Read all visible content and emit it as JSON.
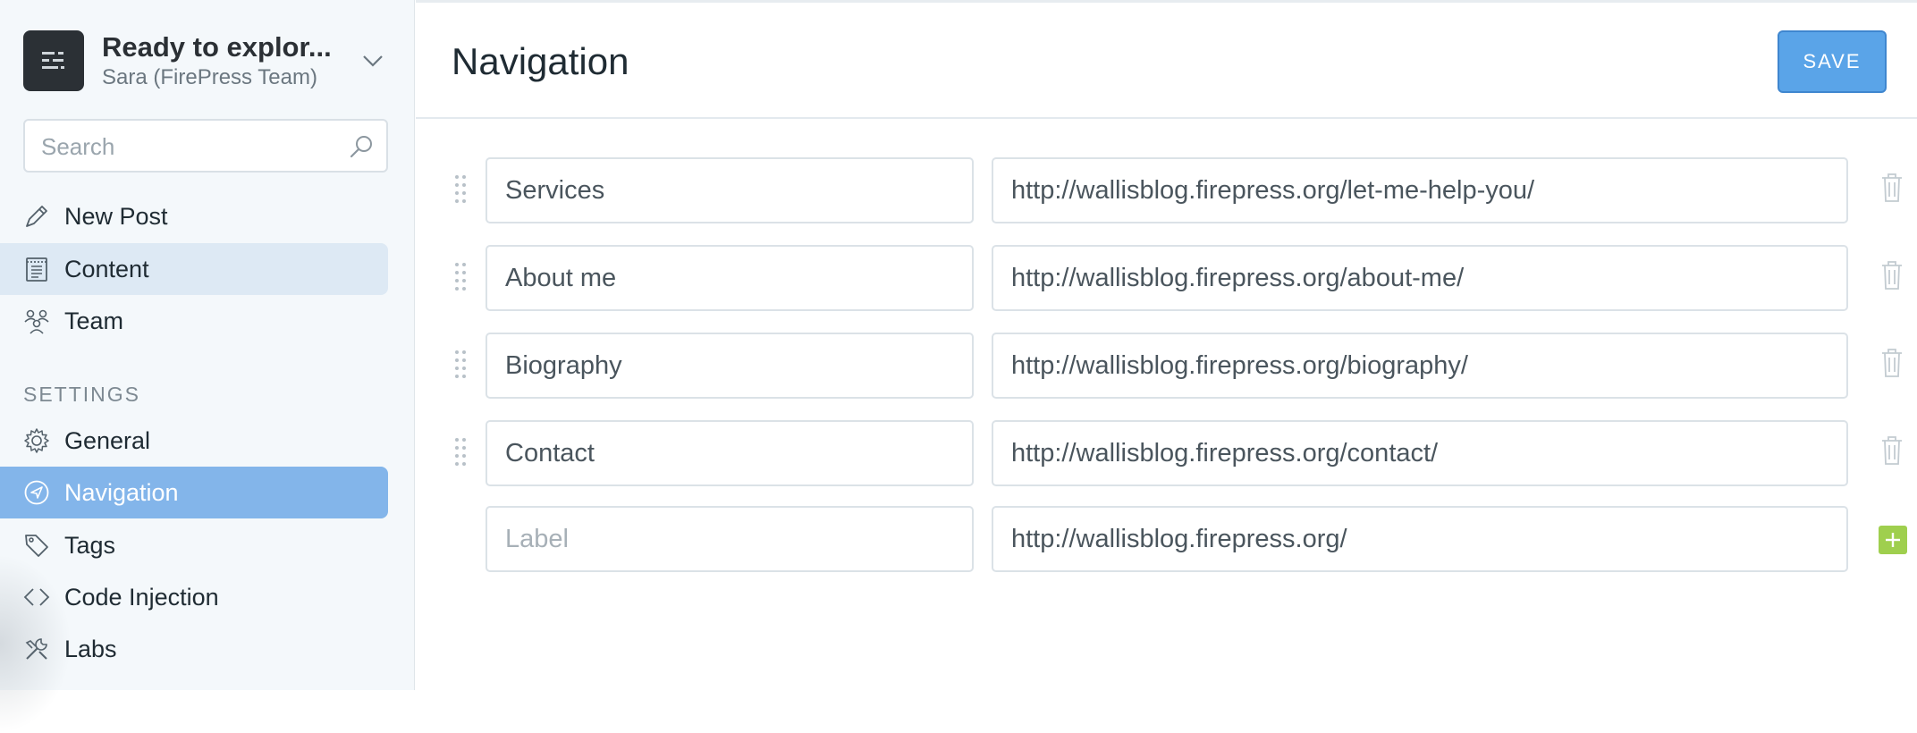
{
  "blog": {
    "title": "Ready to explor...",
    "user": "Sara (FirePress Team)"
  },
  "search": {
    "placeholder": "Search"
  },
  "sidebar": {
    "items": [
      {
        "label": "New Post",
        "icon": "pencil-icon"
      },
      {
        "label": "Content",
        "icon": "content-icon"
      },
      {
        "label": "Team",
        "icon": "team-icon"
      }
    ],
    "settings_label": "SETTINGS",
    "settings_items": [
      {
        "label": "General",
        "icon": "gear-icon"
      },
      {
        "label": "Navigation",
        "icon": "compass-icon"
      },
      {
        "label": "Tags",
        "icon": "tag-icon"
      },
      {
        "label": "Code Injection",
        "icon": "code-icon"
      },
      {
        "label": "Labs",
        "icon": "tools-icon"
      }
    ]
  },
  "page": {
    "title": "Navigation",
    "save_label": "SAVE"
  },
  "navigation": {
    "items": [
      {
        "label": "Services",
        "url": "http://wallisblog.firepress.org/let-me-help-you/"
      },
      {
        "label": "About me",
        "url": "http://wallisblog.firepress.org/about-me/"
      },
      {
        "label": "Biography",
        "url": "http://wallisblog.firepress.org/biography/"
      },
      {
        "label": "Contact",
        "url": "http://wallisblog.firepress.org/contact/"
      }
    ],
    "new_item": {
      "label_placeholder": "Label",
      "url": "http://wallisblog.firepress.org/"
    }
  },
  "colors": {
    "active_nav": "#83b5ea",
    "save_button": "#5aa4e8",
    "add_button": "#9fcf4e"
  }
}
